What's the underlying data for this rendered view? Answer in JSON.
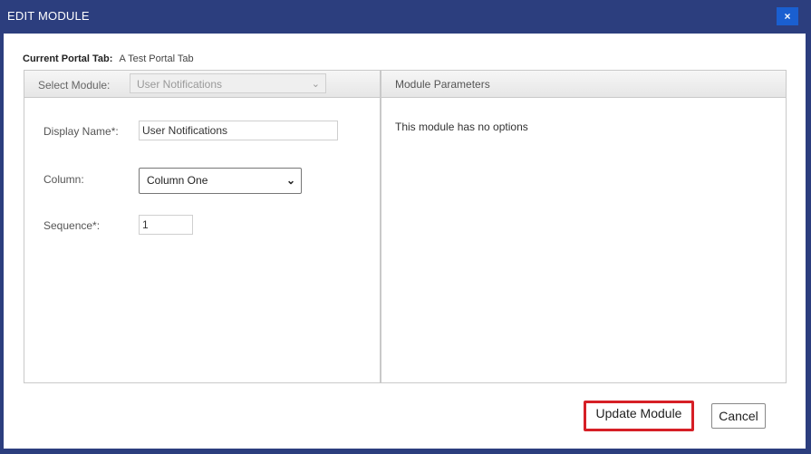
{
  "window": {
    "title": "EDIT MODULE",
    "close_label": "×"
  },
  "portal_tab": {
    "label": "Current Portal Tab:",
    "value": "A Test Portal Tab"
  },
  "left_panel": {
    "select_module_label": "Select Module:",
    "select_module_value": "User Notifications",
    "display_name_label": "Display Name*:",
    "display_name_value": "User Notifications",
    "column_label": "Column:",
    "column_value": "Column One",
    "sequence_label": "Sequence*:",
    "sequence_value": "1"
  },
  "right_panel": {
    "title": "Module Parameters",
    "message": "This module has no options"
  },
  "buttons": {
    "update": "Update Module",
    "cancel": "Cancel"
  },
  "colors": {
    "title_bar": "#2c3e7e",
    "close_button": "#1a5fd0",
    "highlight_border": "#d61f26"
  }
}
